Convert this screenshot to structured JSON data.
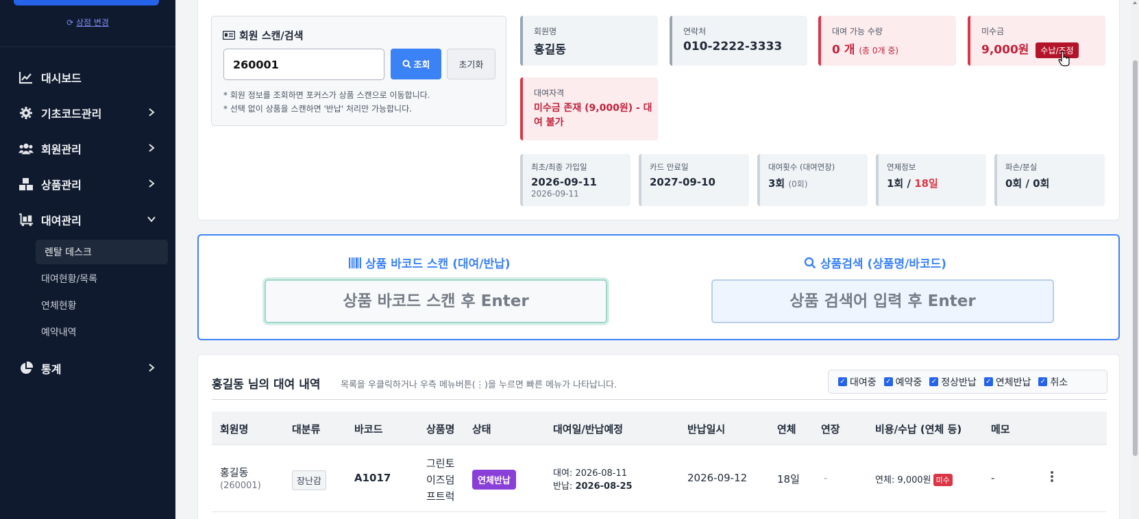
{
  "sidebar": {
    "store_change": "상점 변경",
    "nav": [
      {
        "label": "대시보드"
      },
      {
        "label": "기초코드관리"
      },
      {
        "label": "회원관리"
      },
      {
        "label": "상품관리"
      },
      {
        "label": "대여관리"
      },
      {
        "label": "통계"
      }
    ],
    "sub_items": [
      {
        "label": "렌탈 데스크",
        "active": true
      },
      {
        "label": "대여현황/목록"
      },
      {
        "label": "연체현황"
      },
      {
        "label": "예약내역"
      }
    ]
  },
  "member_search": {
    "title": "회원 스캔/검색",
    "input_value": "260001",
    "lookup_label": "조회",
    "reset_label": "초기화",
    "hint1": "* 회원 정보를 조회하면 포커스가 상품 스캔으로 이동합니다.",
    "hint2": "* 선택 없이 상품을 스캔하면 '반납' 처리만 가능합니다."
  },
  "member_info": {
    "name_label": "회원명",
    "name": "홍길동",
    "phone_label": "연락처",
    "phone": "010-2222-3333",
    "available_label": "대여 가능 수량",
    "available_value": "0 개",
    "available_detail": "(총 0개 중)",
    "unpaid_label": "미수금",
    "unpaid_value": "9,000원",
    "pay_button": "수납/조정",
    "eligibility_label": "대여자격",
    "eligibility_value": "미수금 존재 (9,000원) - 대여 불가"
  },
  "stats": {
    "join_label": "최초/최종 가입일",
    "join_first": "2026-09-11",
    "join_last": "2026-09-11",
    "card_label": "카드 만료일",
    "card_value": "2027-09-10",
    "rent_count_label": "대여횟수 (대여연장)",
    "rent_count": "3회",
    "rent_ext": "(0회)",
    "overdue_label": "연체정보",
    "overdue_count": "1회 /",
    "overdue_days": "18일",
    "damage_label": "파손/분실",
    "damage_value": "0회 / 0회"
  },
  "scan": {
    "barcode_title": "상품 바코드 스캔 (대여/반납)",
    "barcode_placeholder": "상품 바코드 스캔 후 Enter",
    "search_title": "상품검색 (상품명/바코드)",
    "search_placeholder": "상품 검색어 입력 후 Enter"
  },
  "rental_list": {
    "title": "홍길동 님의 대여 내역",
    "hint": "목록을 우클릭하거나 우측 메뉴버튼(⋮)을 누르면 빠른 메뉴가 나타납니다.",
    "filters": [
      "대여중",
      "예약중",
      "정상반납",
      "연체반납",
      "취소"
    ],
    "headers": [
      "회원명",
      "대분류",
      "바코드",
      "상품명",
      "상태",
      "대여일/반납예정",
      "반납일시",
      "연체",
      "연장",
      "비용/수납 (연체 등)",
      "메모"
    ],
    "rows": [
      {
        "member": "홍길동",
        "member_id": "(260001)",
        "category": "장난감",
        "barcode": "A1017",
        "product_1": "그린토",
        "product_2": "이즈덤",
        "product_3": "프트럭",
        "status": "연체반납",
        "rent_prefix": "대여:",
        "rent_date": "2026-08-11",
        "due_prefix": "반납:",
        "due_date": "2026-08-25",
        "returned": "2026-09-12",
        "overdue": "18일",
        "extension": "-",
        "fee": "연체: 9,000원",
        "fee_badge": "미수",
        "memo": "-"
      }
    ]
  },
  "colors": {
    "sidebar_bg": "#0f1a2e",
    "primary": "#3b82f6",
    "danger": "#dc3545",
    "status_overdue_return": "#8b3fd9"
  }
}
